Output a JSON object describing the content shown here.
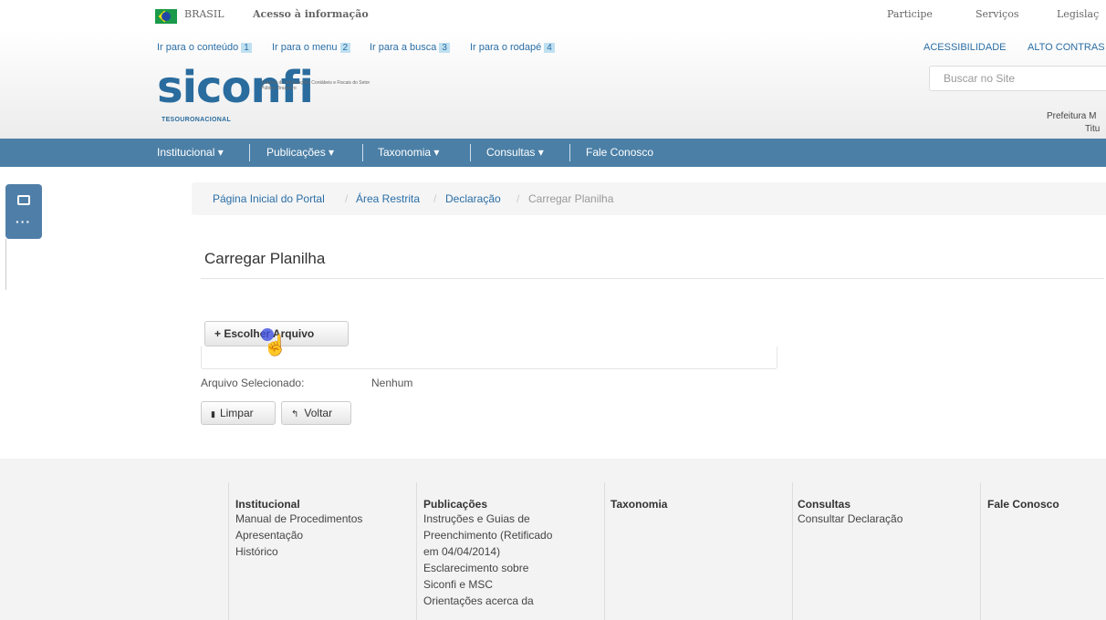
{
  "govbar": {
    "country": "BRASIL",
    "access_info": "Acesso à informação",
    "participe": "Participe",
    "servicos": "Serviços",
    "legislacao": "Legislaç"
  },
  "skip_links": [
    {
      "label": "Ir para o conteúdo",
      "num": "1"
    },
    {
      "label": "Ir para o menu",
      "num": "2"
    },
    {
      "label": "Ir para a busca",
      "num": "3"
    },
    {
      "label": "Ir para o rodapé",
      "num": "4"
    }
  ],
  "accessibility": {
    "acessibilidade": "ACESSIBILIDADE",
    "alto_contraste": "ALTO CONTRAS"
  },
  "search": {
    "placeholder": "Buscar no Site"
  },
  "logo": {
    "name": "siconfi",
    "subtitle": "Sistema de Informações Contábeis e Fiscais do Setor Público Brasileiro",
    "tesouro": "TESOURONACIONAL"
  },
  "user": {
    "line1": "Prefeitura M",
    "line2": "Titu"
  },
  "nav": {
    "institucional": "Institucional ▾",
    "publicacoes": "Publicações ▾",
    "taxonomia": "Taxonomia ▾",
    "consultas": "Consultas ▾",
    "fale_conosco": "Fale Conosco"
  },
  "breadcrumb": {
    "home": "Página Inicial do Portal",
    "restricted": "Área Restrita",
    "declaracao": "Declaração",
    "current": "Carregar Planilha",
    "sep": "/"
  },
  "page": {
    "title": "Carregar Planilha",
    "choose_button": "+ Escolher Arquivo",
    "selected_label": "Arquivo Selecionado:",
    "selected_value": "Nenhum",
    "clear_button": "Limpar",
    "back_button": "Voltar"
  },
  "footer": {
    "institucional": {
      "title": "Institucional",
      "items": [
        "Manual de Procedimentos",
        "Apresentação",
        "Histórico"
      ]
    },
    "publicacoes": {
      "title": "Publicações",
      "items": [
        "Instruções e Guias de",
        "Preenchimento (Retificado",
        "em 04/04/2014)",
        "Esclarecimento sobre",
        "Siconfi e MSC",
        "Orientações acerca da"
      ]
    },
    "taxonomia": {
      "title": "Taxonomia"
    },
    "consultas": {
      "title": "Consultas",
      "items": [
        "Consultar Declaração"
      ]
    },
    "fale": {
      "title": "Fale Conosco"
    }
  },
  "colors": {
    "nav": "#4b7fa6",
    "link": "#2a6ea6",
    "accent_green": "#1f9e5a"
  },
  "icons": [
    "brazil-flag-icon",
    "panel-icon",
    "more-dots-icon",
    "trash-icon",
    "undo-icon",
    "hand-cursor-icon"
  ]
}
